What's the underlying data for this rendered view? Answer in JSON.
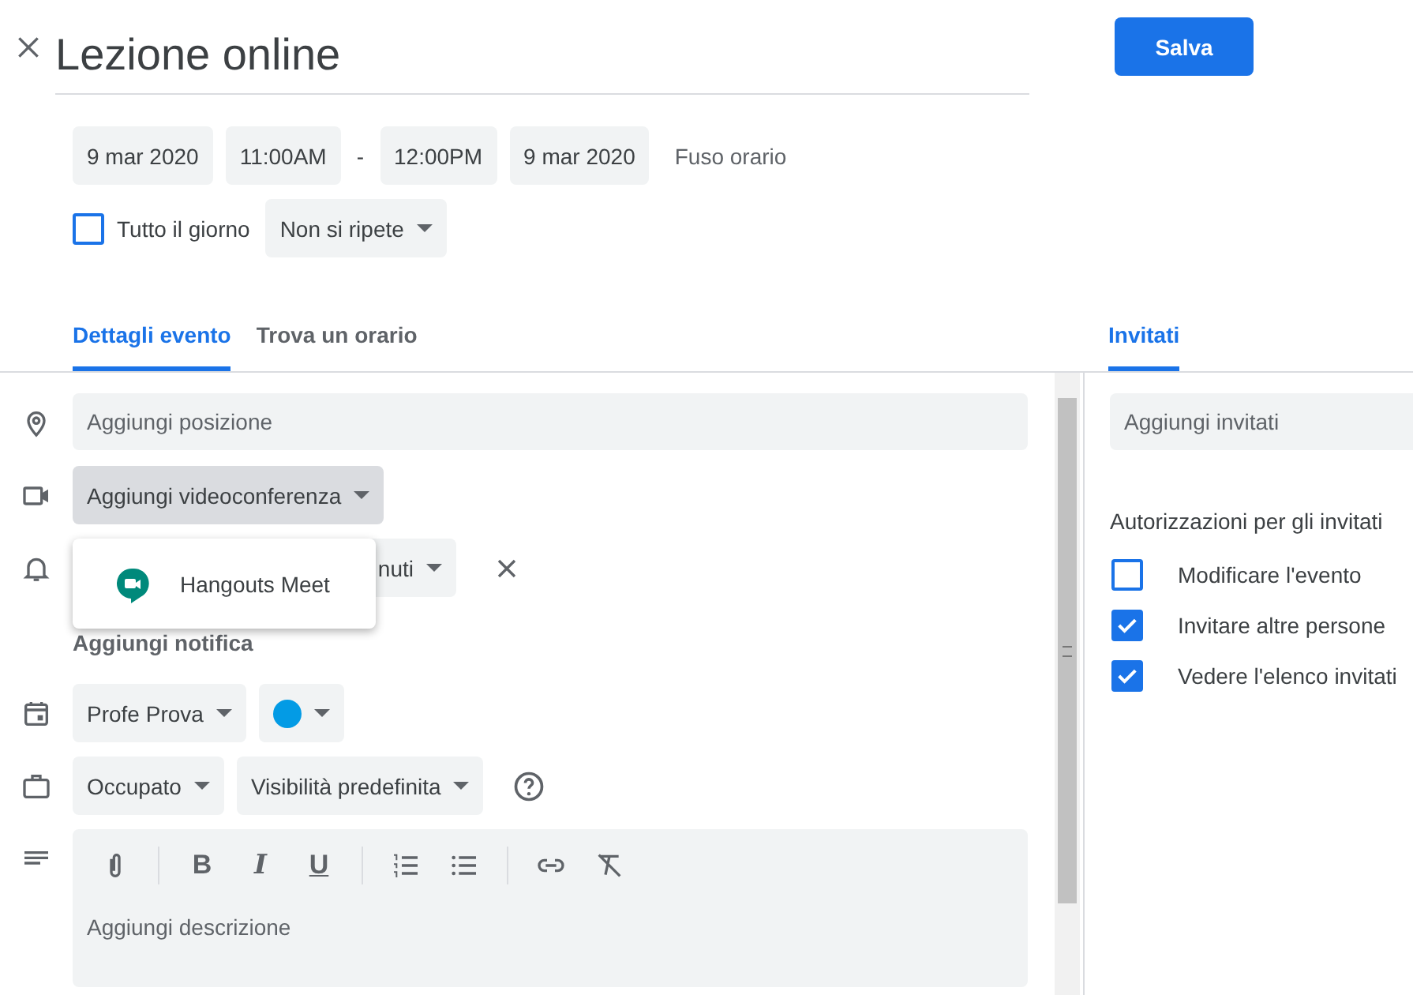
{
  "title": "Lezione online",
  "save_button": "Salva",
  "date_time": {
    "start_date": "9 mar 2020",
    "start_time": "11:00AM",
    "separator": "-",
    "end_time": "12:00PM",
    "end_date": "9 mar 2020",
    "timezone": "Fuso orario"
  },
  "all_day": {
    "label": "Tutto il giorno",
    "checked": false
  },
  "repeat": "Non si ripete",
  "tabs": [
    {
      "label": "Dettagli evento",
      "selected": true
    },
    {
      "label": "Trova un orario",
      "selected": false
    }
  ],
  "details": {
    "location_placeholder": "Aggiungi posizione",
    "conference": "Aggiungi videoconferenza",
    "conference_menu": [
      {
        "label": "Hangouts Meet"
      }
    ],
    "notification": "nuti",
    "add_notification": "Aggiungi notifica",
    "calendar": "Profe Prova",
    "color": "#039be5",
    "availability": "Occupato",
    "visibility": "Visibilità predefinita",
    "format_buttons": [
      "B",
      "I",
      "U"
    ],
    "description_placeholder": "Aggiungi descrizione"
  },
  "guests": {
    "tab": {
      "label": "Invitati",
      "selected": true
    },
    "placeholder": "Aggiungi invitati",
    "permissions_title": "Autorizzazioni per gli invitati",
    "permissions": [
      {
        "label": "Modificare l'evento",
        "checked": false
      },
      {
        "label": "Invitare altre persone",
        "checked": true
      },
      {
        "label": "Vedere l'elenco invitati",
        "checked": true
      }
    ]
  }
}
